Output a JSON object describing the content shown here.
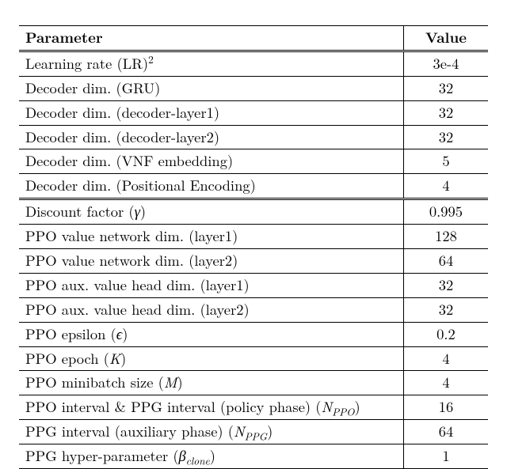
{
  "table": {
    "header": {
      "param": "Parameter",
      "value": "Value"
    },
    "groups": [
      {
        "rows": [
          {
            "param_html": "Learning rate (LR)<sup>2</sup>",
            "value": "3e-4"
          },
          {
            "param_html": "Decoder dim. (GRU)",
            "value": "32"
          },
          {
            "param_html": "Decoder dim. (decoder-layer1)",
            "value": "32"
          },
          {
            "param_html": "Decoder dim. (decoder-layer2)",
            "value": "32"
          },
          {
            "param_html": "Decoder dim. (VNF embedding)",
            "value": "5"
          },
          {
            "param_html": "Decoder dim. (Positional Encoding)",
            "value": "4"
          }
        ]
      },
      {
        "rows": [
          {
            "param_html": "Discount factor (<span class=\"it\">γ</span>)",
            "value": "0.995"
          },
          {
            "param_html": "PPO value network dim. (layer1)",
            "value": "128"
          },
          {
            "param_html": "PPO value network dim. (layer2)",
            "value": "64"
          },
          {
            "param_html": "PPO aux. value head dim. (layer1)",
            "value": "32"
          },
          {
            "param_html": "PPO aux. value head dim. (layer2)",
            "value": "32"
          },
          {
            "param_html": "PPO epsilon (<span class=\"it\">ϵ</span>)",
            "value": "0.2"
          },
          {
            "param_html": "PPO epoch (<span class=\"it\">K</span>)",
            "value": "4"
          },
          {
            "param_html": "PPO minibatch size (<span class=\"it\">M</span>)",
            "value": "4"
          },
          {
            "param_html": "PPO interval &amp; PPG interval (policy phase) (<span class=\"it\">N<sub>PPO</sub></span>)",
            "value": "16"
          },
          {
            "param_html": "PPG interval (auxiliary phase) (<span class=\"it\">N<sub>PPG</sub></span>)",
            "value": "64"
          },
          {
            "param_html": "PPG hyper-parameter (<span class=\"it\">β<sub>clone</sub></span>)",
            "value": "1"
          }
        ]
      }
    ]
  },
  "chart_data": {
    "type": "table",
    "columns": [
      "Parameter",
      "Value"
    ],
    "rows": [
      [
        "Learning rate (LR)^2",
        "3e-4"
      ],
      [
        "Decoder dim. (GRU)",
        32
      ],
      [
        "Decoder dim. (decoder-layer1)",
        32
      ],
      [
        "Decoder dim. (decoder-layer2)",
        32
      ],
      [
        "Decoder dim. (VNF embedding)",
        5
      ],
      [
        "Decoder dim. (Positional Encoding)",
        4
      ],
      [
        "Discount factor (gamma)",
        0.995
      ],
      [
        "PPO value network dim. (layer1)",
        128
      ],
      [
        "PPO value network dim. (layer2)",
        64
      ],
      [
        "PPO aux. value head dim. (layer1)",
        32
      ],
      [
        "PPO aux. value head dim. (layer2)",
        32
      ],
      [
        "PPO epsilon (epsilon)",
        0.2
      ],
      [
        "PPO epoch (K)",
        4
      ],
      [
        "PPO minibatch size (M)",
        4
      ],
      [
        "PPO interval & PPG interval (policy phase) (N_PPO)",
        16
      ],
      [
        "PPG interval (auxiliary phase) (N_PPG)",
        64
      ],
      [
        "PPG hyper-parameter (beta_clone)",
        1
      ]
    ]
  }
}
